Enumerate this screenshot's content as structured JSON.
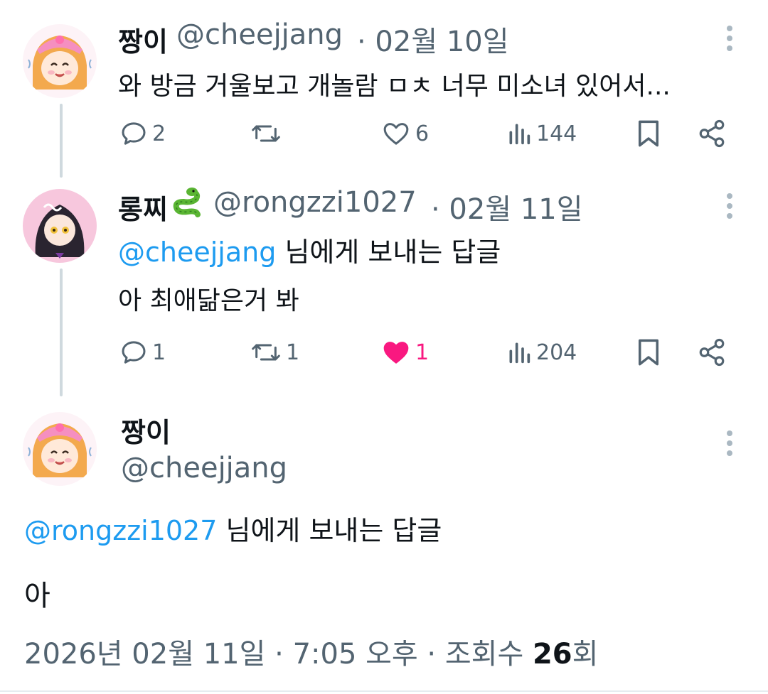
{
  "tweets": [
    {
      "name": "짱이",
      "handle": "@cheejjang",
      "date": "· 02월 10일",
      "text": "와 방금 거울보고 개놀람 ㅁㅊ 너무 미소녀 있어서...",
      "reply_count": "2",
      "retweet_count": "",
      "like_count": "6",
      "view_count": "144"
    },
    {
      "name": "롱찌",
      "handle": "@rongzzi1027",
      "date": "· 02월 11일",
      "reply_to_mention": "@cheejjang",
      "reply_to_suffix": "님에게 보내는 답글",
      "text": "아 최애닮은거 봐",
      "reply_count": "1",
      "retweet_count": "1",
      "like_count": "1",
      "view_count": "204"
    }
  ],
  "main": {
    "name": "짱이",
    "handle": "@cheejjang",
    "reply_to_mention": "@rongzzi1027",
    "reply_to_suffix": "님에게 보내는 답글",
    "text": "아",
    "timestamp": "2026년 02월 11일 · 7:05 오후 · 조회수 ",
    "views": "26",
    "views_unit": "회"
  },
  "icons": [
    "reply-icon",
    "retweet-icon",
    "like-icon",
    "views-icon",
    "bookmark-icon",
    "share-icon",
    "more-icon",
    "snake-emoji"
  ],
  "colors": {
    "accent": "#1d9bf0",
    "like": "#f91880",
    "secondary_text": "#536471",
    "avatar_pink": "#f7c7dd"
  }
}
